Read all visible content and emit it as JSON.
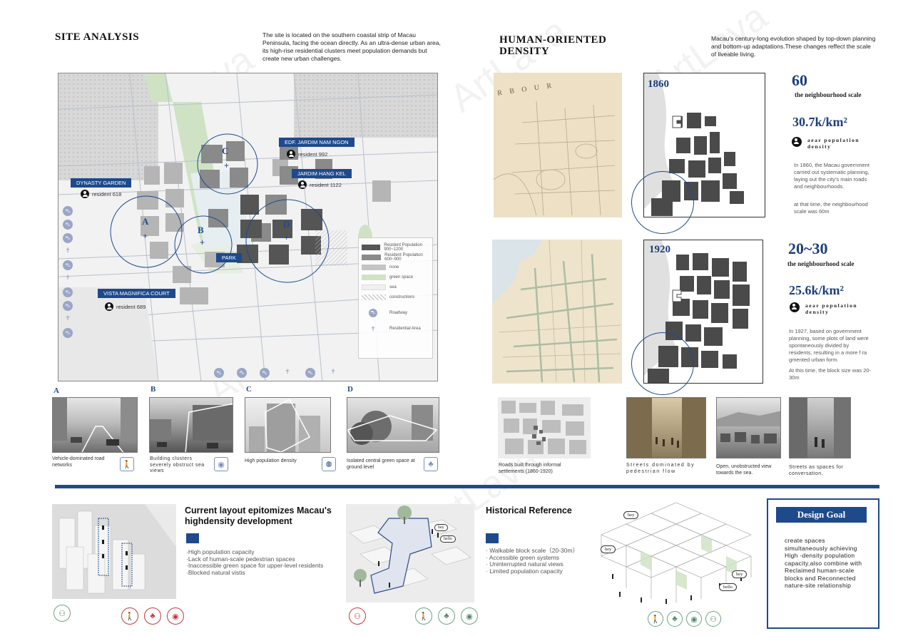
{
  "site": {
    "title": "SITE ANALYSIS",
    "intro": "The site is located on the southern coastal strip of Macau Peninsula, facing the ocean directly. As an ultra-dense urban area, its high-rise residential clusters meet population demands but create new urban challenges."
  },
  "map": {
    "circles": [
      "A",
      "B",
      "C",
      "D"
    ],
    "places": [
      {
        "name": "EDF. JARDIM NAM NGON",
        "resident": "resident  992"
      },
      {
        "name": "JARDIM HANG KEL",
        "resident": "resident  1122"
      },
      {
        "name": "DYNASTY GARDEN",
        "resident": "resident  618"
      },
      {
        "name": "VISTA MAGNIFICA COURT",
        "resident": "resident  689"
      },
      {
        "name": "PARK",
        "resident": ""
      }
    ],
    "legend": [
      {
        "label": "Resident Population 900~1200",
        "color": "#555555"
      },
      {
        "label": "Resident Population 600~900",
        "color": "#8a8a8a"
      },
      {
        "label": "none",
        "color": "#c4c4c4"
      },
      {
        "label": "green space",
        "color": "#cfe3c4"
      },
      {
        "label": "sea",
        "color": "#f0f0f0"
      },
      {
        "label": "constructions",
        "color": "hatch"
      },
      {
        "label": "Roadway",
        "color": "icon"
      },
      {
        "label": "Residential Area",
        "color": "icon"
      }
    ]
  },
  "photos": [
    {
      "letter": "A",
      "caption": "Vehicle-dominated road networks",
      "icon": "pedestrian-icon"
    },
    {
      "letter": "B",
      "caption": "Building clusters severely obstruct sea views",
      "icon": "eye-icon"
    },
    {
      "letter": "C",
      "caption": "High population density",
      "icon": "crowd-icon"
    },
    {
      "letter": "D",
      "caption": "Isolated central green space at ground level",
      "icon": "tree-icon"
    }
  ],
  "density": {
    "title_line1": "HUMAN-ORIENTED",
    "title_line2": "DENSITY",
    "intro": "Macau's century-long evolution shaped by top-down planning and bottom-up adaptations.These changes reffect the scale of liveable living.",
    "map1_text": "R B O U R",
    "y1860": {
      "year": "1860",
      "scale_num": "60",
      "scale_label": "the neighbourhood scale",
      "pop": "30.7k/km²",
      "pop_label": "aear population density",
      "desc1": "In 1860, the Macau government carried out systematic planning, laying out the city's main roads and neighbourhoods.",
      "desc2": "at that time, the neighbourhood scale was 60m"
    },
    "y1920": {
      "year": "1920",
      "scale_num": "20~30",
      "scale_label": "the neighbourhood scale",
      "pop": "25.6k/km²",
      "pop_label": "aear population density",
      "desc1": "In 1927, based on government planning, some plots of land were spontaneously divided by residents, resulting in a more f ra gmented urban form.",
      "desc2": "At this time, the block size was 20-30m"
    },
    "captions": [
      "Roads built through informal settlements (1860-1920)",
      "Streets dominated by pedestrian flow",
      "Open, unobstructed view towards the sea.",
      "Streets as spaces for conversation."
    ]
  },
  "bottom": {
    "current": {
      "title": "Current layout epitomizes Macau's highdensity development",
      "items": [
        "·High population capacity",
        "·Lack of human-scale pedestrian spaces",
        "·Inaccessible green space for upper-level residents",
        "·Blocked natural vistis"
      ]
    },
    "historical": {
      "title": "Historical Reference",
      "items": [
        "· Walkable block scale（20-30m）",
        "· Accessible green systems",
        "· Uninterrupted natural views",
        "· Limited population capacity"
      ],
      "bubbles": [
        "hey",
        "hello"
      ]
    },
    "goal": {
      "bubbles": [
        "hey",
        "hey",
        "hey",
        "hello"
      ],
      "title": "Design Goal",
      "text": "create spaces simultaneously achieving High -density population capacity,also combine with Reclaimed human-scale blocks and Reconnected nature-site relationship"
    }
  },
  "colors": {
    "accent": "#1e4a8c",
    "green": "#cfe3c4",
    "red": "#c23a3a",
    "teal": "#4f8b6b"
  }
}
